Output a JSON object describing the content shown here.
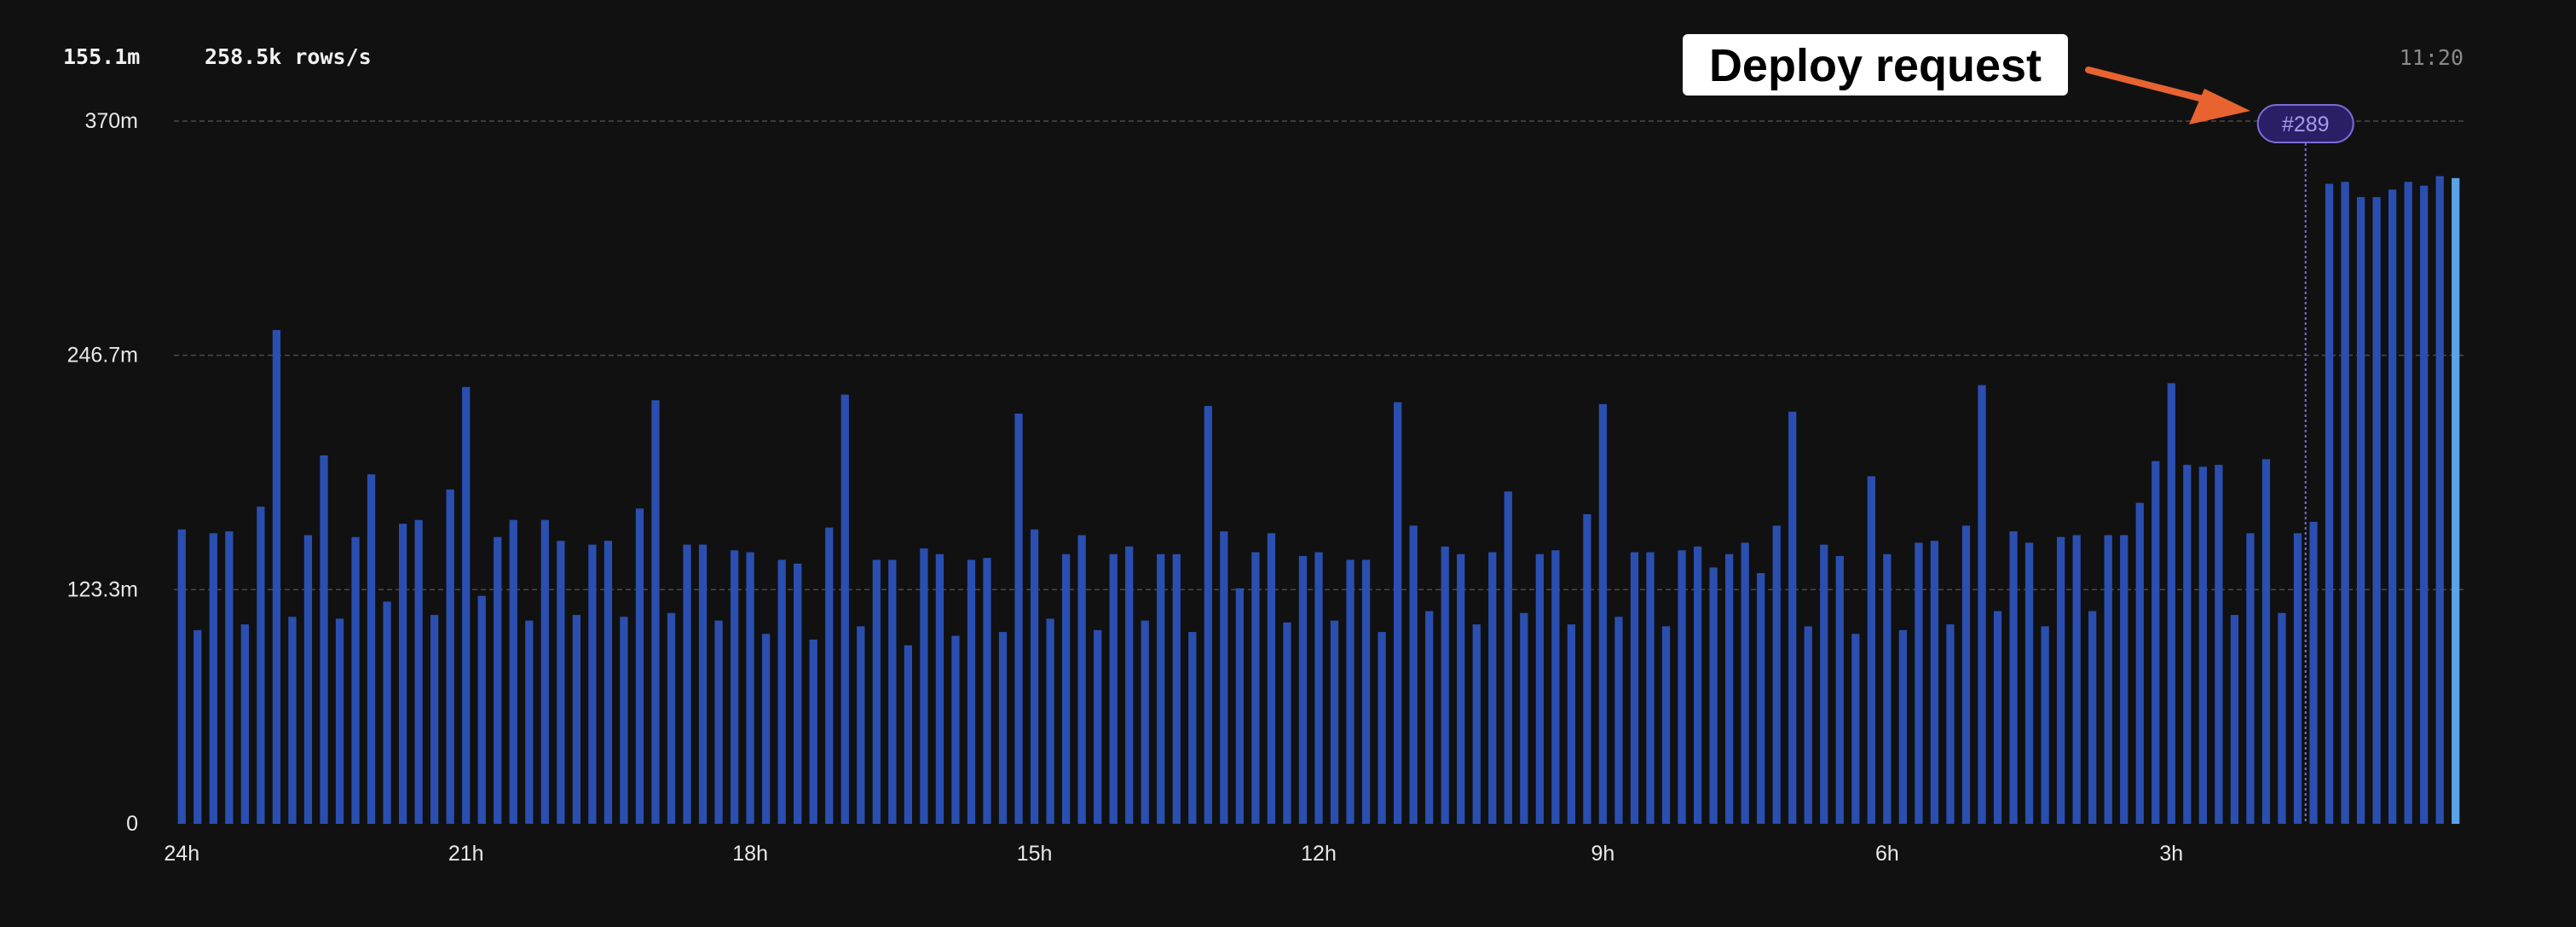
{
  "header": {
    "total": "155.1m",
    "rate": "258.5k rows/s",
    "time": "11:20"
  },
  "annotation": {
    "callout": "Deploy request",
    "marker_label": "#289"
  },
  "colors": {
    "background": "#111112",
    "bar": "#2a4fb0",
    "bar_current": "#5aa3e6",
    "gridline": "#4a4a4a",
    "marker": "#7e6ad6",
    "callout_arrow": "#e8632f"
  },
  "chart_data": {
    "type": "bar",
    "ylim": [
      0,
      370
    ],
    "yticks": [
      0,
      123.3,
      246.7,
      370
    ],
    "ytick_labels": [
      "0",
      "123.3m",
      "246.7m",
      "370m"
    ],
    "xtick_labels": [
      "24h",
      "21h",
      "18h",
      "15h",
      "12h",
      "9h",
      "6h",
      "3h"
    ],
    "xtick_bar_index": [
      0,
      18,
      36,
      54,
      72,
      90,
      108,
      126
    ],
    "grid": true,
    "deploy_marker_bar_index": 134,
    "values": [
      155,
      102,
      153,
      154,
      105,
      167,
      260,
      109,
      152,
      194,
      108,
      151,
      184,
      117,
      158,
      160,
      110,
      176,
      230,
      120,
      151,
      160,
      107,
      160,
      149,
      110,
      147,
      149,
      109,
      166,
      223,
      111,
      147,
      147,
      107,
      144,
      143,
      100,
      139,
      137,
      97,
      156,
      226,
      104,
      139,
      139,
      94,
      145,
      142,
      99,
      139,
      140,
      101,
      216,
      155,
      108,
      142,
      152,
      102,
      142,
      146,
      107,
      142,
      142,
      101,
      220,
      154,
      124,
      143,
      153,
      106,
      141,
      143,
      107,
      139,
      139,
      101,
      222,
      157,
      112,
      146,
      142,
      105,
      143,
      175,
      111,
      142,
      144,
      105,
      163,
      221,
      109,
      143,
      143,
      104,
      144,
      146,
      135,
      142,
      148,
      132,
      157,
      217,
      104,
      147,
      141,
      100,
      183,
      142,
      102,
      148,
      149,
      105,
      157,
      231,
      112,
      154,
      148,
      104,
      151,
      152,
      112,
      152,
      152,
      169,
      191,
      232,
      189,
      188,
      189,
      110,
      153,
      192,
      111,
      153,
      159,
      337,
      338,
      330,
      330,
      334,
      338,
      336,
      341,
      340
    ]
  }
}
